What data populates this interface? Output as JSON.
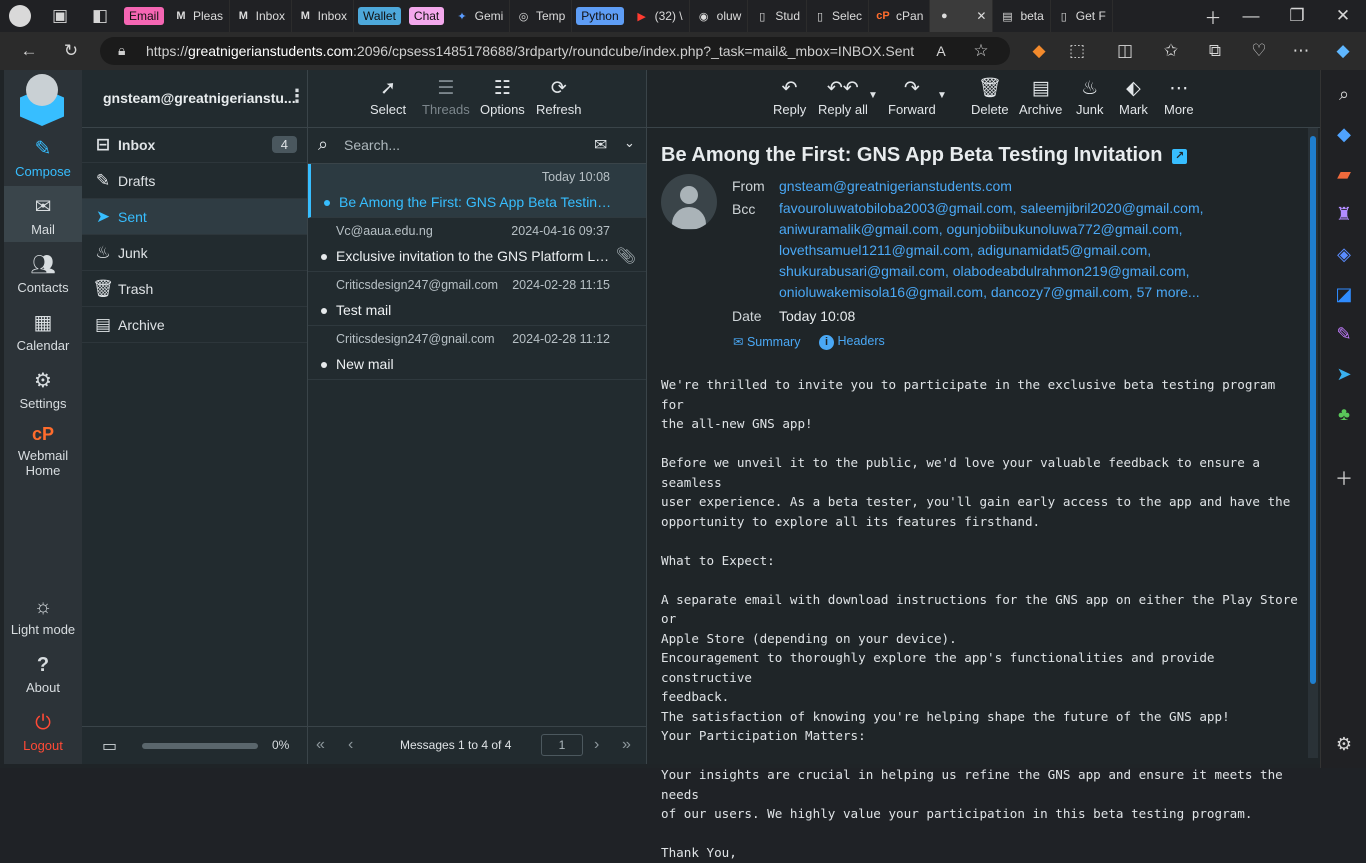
{
  "browser": {
    "tabs": [
      {
        "group": "Email",
        "group_color": "#f566b3"
      },
      {
        "icon": "M",
        "label": "Pleas"
      },
      {
        "icon": "M",
        "label": "Inbox"
      },
      {
        "icon": "M",
        "label": "Inbox"
      },
      {
        "group": "Wallet",
        "group_color": "#4da8da"
      },
      {
        "group": "Chat",
        "group_color": "#f3a8ec"
      },
      {
        "icon": "✦",
        "label": "Gemi"
      },
      {
        "icon": "◎",
        "label": "Temp"
      },
      {
        "group": "Python",
        "group_color": "#5e9df5"
      },
      {
        "icon": "▶",
        "label": "(32) \\"
      },
      {
        "icon": "◉",
        "label": "oluw"
      },
      {
        "icon": "▯",
        "label": "Stud"
      },
      {
        "icon": "▯",
        "label": "Selec"
      },
      {
        "icon": "cP",
        "label": "cPan"
      },
      {
        "icon": "●",
        "label": ""
      },
      {
        "icon": "▤",
        "label": "beta"
      },
      {
        "icon": "▯",
        "label": "Get F"
      }
    ],
    "url_prefix": "https://",
    "url_host": "greatnigerianstudents.com",
    "url_rest": ":2096/cpsess1485178688/3rdparty/roundcube/index.php?_task=mail&_mbox=INBOX.Sent"
  },
  "nav": {
    "compose": "Compose",
    "mail": "Mail",
    "contacts": "Contacts",
    "calendar": "Calendar",
    "settings": "Settings",
    "webmail_home_1": "Webmail",
    "webmail_home_2": "Home",
    "light_mode": "Light mode",
    "about": "About",
    "logout": "Logout"
  },
  "account": "gnsteam@greatnigerianstu...",
  "folders": {
    "inbox": "Inbox",
    "inbox_count": "4",
    "drafts": "Drafts",
    "sent": "Sent",
    "junk": "Junk",
    "trash": "Trash",
    "archive": "Archive",
    "quota": "0%"
  },
  "list_toolbar": {
    "select": "Select",
    "threads": "Threads",
    "options": "Options",
    "refresh": "Refresh"
  },
  "search": {
    "placeholder": "Search..."
  },
  "messages": [
    {
      "from": "",
      "date": "Today 10:08",
      "subject": "Be Among the First: GNS App Beta Testing Invitation"
    },
    {
      "from": "Vc@aaua.edu.ng",
      "date": "2024-04-16 09:37",
      "subject": "Exclusive invitation to the GNS Platform Launch"
    },
    {
      "from": "Criticsdesign247@gmail.com",
      "date": "2024-02-28 11:15",
      "subject": "Test mail"
    },
    {
      "from": "Criticsdesign247@gnail.com",
      "date": "2024-02-28 11:12",
      "subject": "New mail"
    }
  ],
  "pager": {
    "summary": "Messages 1 to 4 of 4",
    "page": "1"
  },
  "preview_toolbar": {
    "reply": "Reply",
    "reply_all": "Reply all",
    "forward": "Forward",
    "delete": "Delete",
    "archive": "Archive",
    "junk": "Junk",
    "mark": "Mark",
    "more": "More"
  },
  "email": {
    "subject": "Be Among the First: GNS App Beta Testing Invitation",
    "from_label": "From",
    "from": "gnsteam@greatnigerianstudents.com",
    "bcc_label": "Bcc",
    "bcc_lines": [
      "favouroluwatobiloba2003@gmail.com, saleemjibril2020@gmail.com,",
      "aniwuramalik@gmail.com, ogunjobiibukunoluwa772@gmail.com,",
      "lovethsamuel1211@gmail.com, adigunamidat5@gmail.com,",
      "shukurabusari@gmail.com, olabodeabdulrahmon219@gmail.com,",
      "onioluwakemisola16@gmail.com, dancozy7@gmail.com, 57 more..."
    ],
    "date_label": "Date",
    "date": "Today 10:08",
    "summary_link": "Summary",
    "headers_link": "Headers",
    "body": "We're thrilled to invite you to participate in the exclusive beta testing program for\nthe all-new GNS app!\n\nBefore we unveil it to the public, we'd love your valuable feedback to ensure a seamless\nuser experience. As a beta tester, you'll gain early access to the app and have the\nopportunity to explore all its features firsthand.\n\nWhat to Expect:\n\nA separate email with download instructions for the GNS app on either the Play Store or\nApple Store (depending on your device).\nEncouragement to thoroughly explore the app's functionalities and provide constructive\nfeedback.\nThe satisfaction of knowing you're helping shape the future of the GNS app!\nYour Participation Matters:\n\nYour insights are crucial in helping us refine the GNS app and ensure it meets the needs\nof our users. We highly value your participation in this beta testing program.\n\nThank You,"
  },
  "colors": {
    "accent": "#37beff",
    "logout": "#ff4a36",
    "cpanel": "#ff6c2c"
  }
}
